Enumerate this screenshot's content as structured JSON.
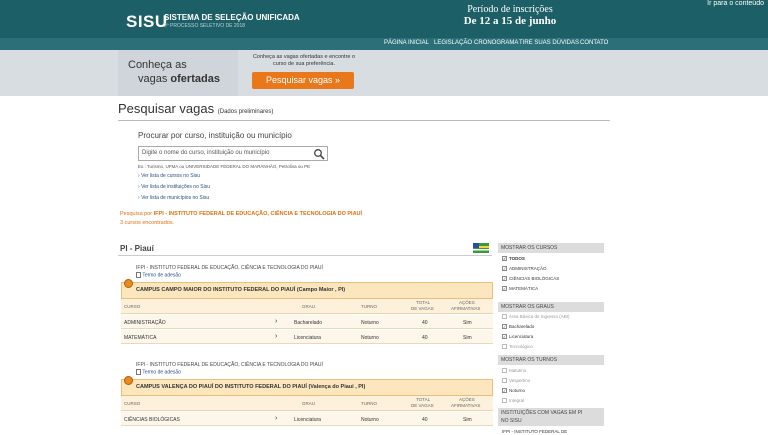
{
  "header": {
    "logo": "SISU",
    "logo_sub": "SISTEMA DE SELEÇÃO UNIFICADA",
    "logo_sub2": "2º PROCESSO SELETIVO DE 2018",
    "skip_link": "Ir para o conteúdo",
    "period_title": "Período de inscrições",
    "period_dates": "De 12 a 15 de junho"
  },
  "nav": [
    "PÁGINA INICIAL",
    "LEGISLAÇÃO",
    "CRONOGRAMA",
    "TIRE SUAS DÚVIDAS",
    "CONTATO"
  ],
  "promo": {
    "line1": "Conheça as",
    "line2_a": "vagas ",
    "line2_b": "ofertadas",
    "desc": "Conheça as vagas ofertadas e encontre o curso de sua preferência.",
    "button": "Pesquisar vagas  »"
  },
  "page": {
    "title": "Pesquisar vagas",
    "title_note": "(Dados preliminares)"
  },
  "search": {
    "label": "Procurar por curso, instituição ou município",
    "placeholder": "Digite o nome do curso, instituição ou município",
    "example": "Ex.: Turismo, UFMA ou UNIVERSIDADE FEDERAL DO MARANHÃO, Petrolina ou PE",
    "links": [
      "Ver lista de cursos no Sisu",
      "Ver lista de instituições no Sisu",
      "Ver lista de municípios no Sisu"
    ]
  },
  "results": {
    "filter_prefix": "Pesquisa por ",
    "filter_value": "IFPI - INSTITUTO FEDERAL DE EDUCAÇÃO, CIÊNCIA E TECNOLOGIA DO PIAUÍ",
    "found": "3 cursos encontrados.",
    "state": "PI - Piauí"
  },
  "table_headers": {
    "curso": "CURSO",
    "grau": "GRAU",
    "turno": "TURNO",
    "total1": "TOTAL",
    "total2": "DE VAGAS",
    "acoes1": "AÇÕES",
    "acoes2": "AFIRMATIVAS"
  },
  "groups": [
    {
      "institution": "IFPI - INSTITUTO FEDERAL DE EDUCAÇÃO, CIÊNCIA E TECNOLOGIA DO PIAUÍ",
      "term": "Termo de adesão",
      "campus": "CAMPUS CAMPO MAIOR DO INSTITUTO FEDERAL DO PIAUÍ (Campo Maior , PI)",
      "rows": [
        {
          "curso": "ADMINISTRAÇÃO",
          "grau": "Bacharelado",
          "turno": "Noturno",
          "vagas": "40",
          "acoes": "Sim"
        },
        {
          "curso": "MATEMÁTICA",
          "grau": "Licenciatura",
          "turno": "Noturno",
          "vagas": "40",
          "acoes": "Sim"
        }
      ]
    },
    {
      "institution": "IFPI - INSTITUTO FEDERAL DE EDUCAÇÃO, CIÊNCIA E TECNOLOGIA DO PIAUÍ",
      "term": "Termo de adesão",
      "campus": "CAMPUS VALENÇA DO PIAUÍ DO INSTITUTO FEDERAL DO PIAUÍ (Valença do Piauí , PI)",
      "rows": [
        {
          "curso": "CIÊNCIAS BIOLÓGICAS",
          "grau": "Licenciatura",
          "turno": "Noturno",
          "vagas": "40",
          "acoes": "Sim"
        }
      ]
    }
  ],
  "sidebar": {
    "cursos_title": "MOSTRAR OS CURSOS",
    "cursos": [
      {
        "label": "TODOS",
        "checked": true,
        "bold": true
      },
      {
        "label": "ADMINISTRAÇÃO",
        "checked": true
      },
      {
        "label": "CIÊNCIAS BIOLÓGICAS",
        "checked": true
      },
      {
        "label": "MATEMÁTICA",
        "checked": true
      }
    ],
    "graus_title": "MOSTRAR OS GRAUS",
    "graus": [
      {
        "label": "Área Básica de Ingresso (ABI)",
        "checked": false
      },
      {
        "label": "Bacharelado",
        "checked": true
      },
      {
        "label": "Licenciatura",
        "checked": true
      },
      {
        "label": "Tecnológico",
        "checked": false
      }
    ],
    "turnos_title": "MOSTRAR OS TURNOS",
    "turnos": [
      {
        "label": "Matutino",
        "checked": false
      },
      {
        "label": "Vespertino",
        "checked": false
      },
      {
        "label": "Noturno",
        "checked": true
      },
      {
        "label": "Integral",
        "checked": false
      }
    ],
    "inst_title1": "INSTITUIÇÕES COM VAGAS EM PI",
    "inst_title2": "NO SISU",
    "inst_item": "IFPI - INSTITUTO FEDERAL DE"
  },
  "colors": {
    "banner": "#1d5f66",
    "accent": "#e8781a",
    "link": "#2b4f80"
  }
}
